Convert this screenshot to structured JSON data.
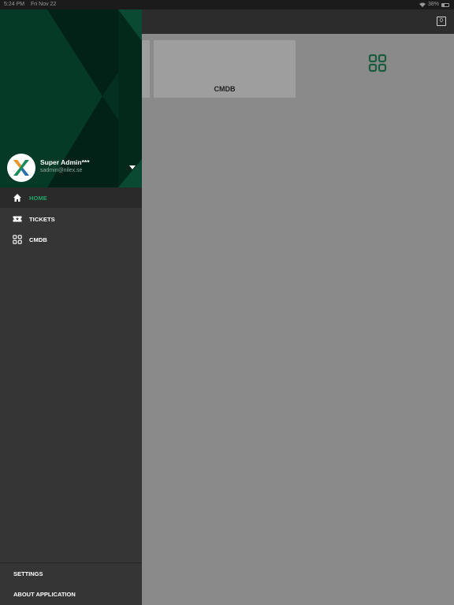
{
  "status_bar": {
    "time": "5:24 PM",
    "date": "Fri Nov 22",
    "battery": "38%"
  },
  "app_bar": {
    "badge_count": "0"
  },
  "content": {
    "cards": [
      {
        "label": "CMDB",
        "icon": "grid-squares-icon"
      }
    ]
  },
  "drawer": {
    "user": {
      "name": "Super Admin***",
      "email": "sadmin@nilex.se"
    },
    "nav": [
      {
        "label": "HOME",
        "icon": "home-icon",
        "active": true
      },
      {
        "label": "TICKETS",
        "icon": "ticket-icon",
        "active": false
      },
      {
        "label": "CMDB",
        "icon": "grid-squares-icon",
        "active": false
      }
    ],
    "footer": {
      "settings_label": "SETTINGS",
      "about_label": "ABOUT APPLICATION"
    }
  },
  "colors": {
    "accent": "#1fa36b",
    "header_bg": "#03291b",
    "drawer_bg": "#353535",
    "scrim": "#8a8a8a"
  }
}
